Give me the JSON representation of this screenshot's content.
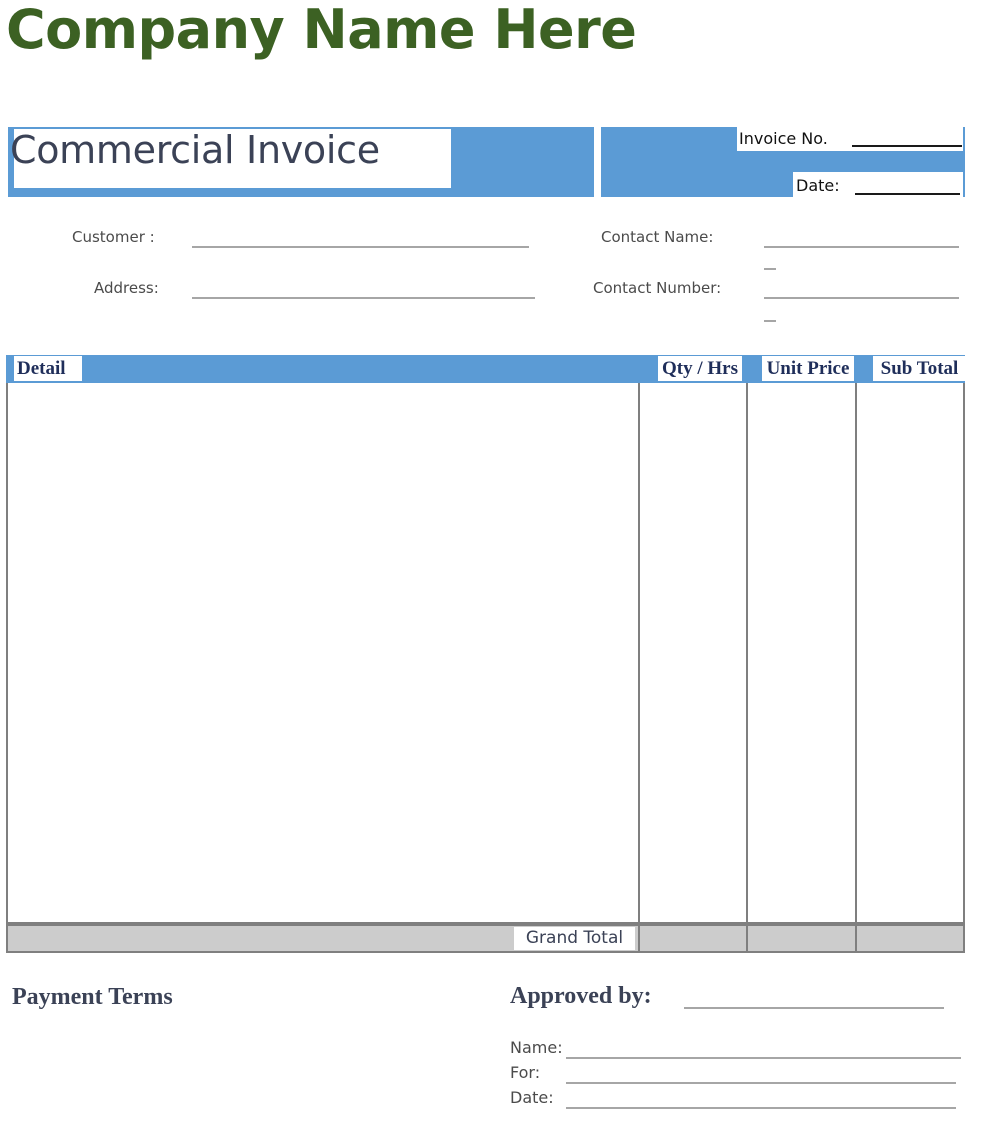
{
  "company": {
    "name": "Company Name Here",
    "color": "#3C6123"
  },
  "header": {
    "title": "Commercial Invoice",
    "accent_color": "#5B9BD5",
    "title_color": "#3B4256",
    "invoice_no_label": "Invoice No.",
    "invoice_no_value": "",
    "date_label": "Date:",
    "date_value": ""
  },
  "customer_block": {
    "customer_label": "Customer :",
    "customer_value": "",
    "address_label": "Address:",
    "address_value": "",
    "contact_name_label": "Contact Name:",
    "contact_name_value": "",
    "contact_number_label": "Contact Number:",
    "contact_number_value": ""
  },
  "items_table": {
    "columns": [
      {
        "key": "detail",
        "label": "Detail"
      },
      {
        "key": "qty",
        "label": "Qty / Hrs"
      },
      {
        "key": "unit_price",
        "label": "Unit Price"
      },
      {
        "key": "sub_total",
        "label": "Sub Total"
      }
    ],
    "rows": [],
    "header_bg": "#5B9BD5",
    "header_text_color": "#1F2E5A",
    "grid_color": "#7F7F7F",
    "grand_total_label": "Grand Total",
    "grand_total_qty": "",
    "grand_total_unit_price": "",
    "grand_total_value": "",
    "grand_total_bg": "#CCCCCC"
  },
  "footer": {
    "payment_terms_title": "Payment Terms",
    "payment_terms_body": "",
    "approved_by_label": "Approved by:",
    "approved_by_value": "",
    "name_label": "Name:",
    "name_value": "",
    "for_label": "For:",
    "for_value": "",
    "date_label": "Date:",
    "date_value": ""
  }
}
